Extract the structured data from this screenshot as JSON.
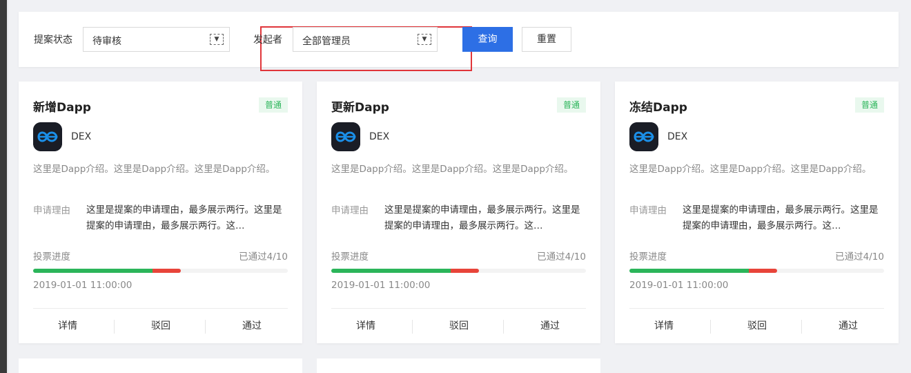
{
  "filters": {
    "status_label": "提案状态",
    "status_value": "待审核",
    "initiator_label": "发起者",
    "initiator_value": "全部管理员",
    "dropdown_icon": "chevron-down-icon",
    "query_button": "查询",
    "reset_button": "重置"
  },
  "colors": {
    "primary": "#2d6fe5",
    "tag_green": "#2bb55a",
    "progress_pass": "#2bb55a",
    "progress_reject": "#e8443a",
    "highlight": "#e0353a"
  },
  "cards": [
    {
      "title": "新增Dapp",
      "tag": "普通",
      "dapp_name": "DEX",
      "description": "这里是Dapp介绍。这里是Dapp介绍。这里是Dapp介绍。",
      "reason_label": "申请理由",
      "reason": "这里是提案的申请理由，最多展示两行。这里是提案的申请理由，最多展示两行。这…",
      "vote_label": "投票进度",
      "vote_count": "已通过4/10",
      "progress_pass": 0.47,
      "progress_reject": 0.11,
      "time": "2019-01-01 11:00:00",
      "actions": [
        "详情",
        "驳回",
        "通过"
      ]
    },
    {
      "title": "更新Dapp",
      "tag": "普通",
      "dapp_name": "DEX",
      "description": "这里是Dapp介绍。这里是Dapp介绍。这里是Dapp介绍。",
      "reason_label": "申请理由",
      "reason": "这里是提案的申请理由，最多展示两行。这里是提案的申请理由，最多展示两行。这…",
      "vote_label": "投票进度",
      "vote_count": "已通过4/10",
      "progress_pass": 0.47,
      "progress_reject": 0.11,
      "time": "2019-01-01 11:00:00",
      "actions": [
        "详情",
        "驳回",
        "通过"
      ]
    },
    {
      "title": "冻结Dapp",
      "tag": "普通",
      "dapp_name": "DEX",
      "description": "这里是Dapp介绍。这里是Dapp介绍。这里是Dapp介绍。",
      "reason_label": "申请理由",
      "reason": "这里是提案的申请理由，最多展示两行。这里是提案的申请理由，最多展示两行。这…",
      "vote_label": "投票进度",
      "vote_count": "已通过4/10",
      "progress_pass": 0.47,
      "progress_reject": 0.11,
      "time": "2019-01-01 11:00:00",
      "actions": [
        "详情",
        "驳回",
        "通过"
      ]
    }
  ]
}
